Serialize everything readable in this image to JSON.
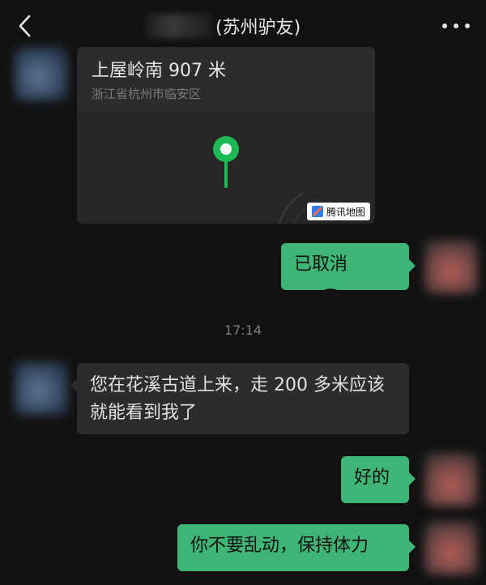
{
  "header": {
    "title": "(苏州驴友)",
    "back_icon": "chevron-left-icon",
    "more_icon": "more-icon"
  },
  "location_message": {
    "place": "上屋岭南 907 米",
    "address": "浙江省杭州市临安区",
    "map_brand": "腾讯地图",
    "pin_color": "#1db954"
  },
  "call_message": {
    "text": "已取消",
    "icon": "phone-hangup-icon"
  },
  "timestamp": "17:14",
  "messages": [
    {
      "side": "in",
      "text": "您在花溪古道上来，走 200 多米应该就能看到我了"
    },
    {
      "side": "out",
      "text": "好的"
    },
    {
      "side": "out",
      "text": "你不要乱动，保持体力"
    }
  ],
  "colors": {
    "background": "#111111",
    "incoming_bubble": "#2c2c2c",
    "outgoing_bubble": "#3eb575"
  }
}
